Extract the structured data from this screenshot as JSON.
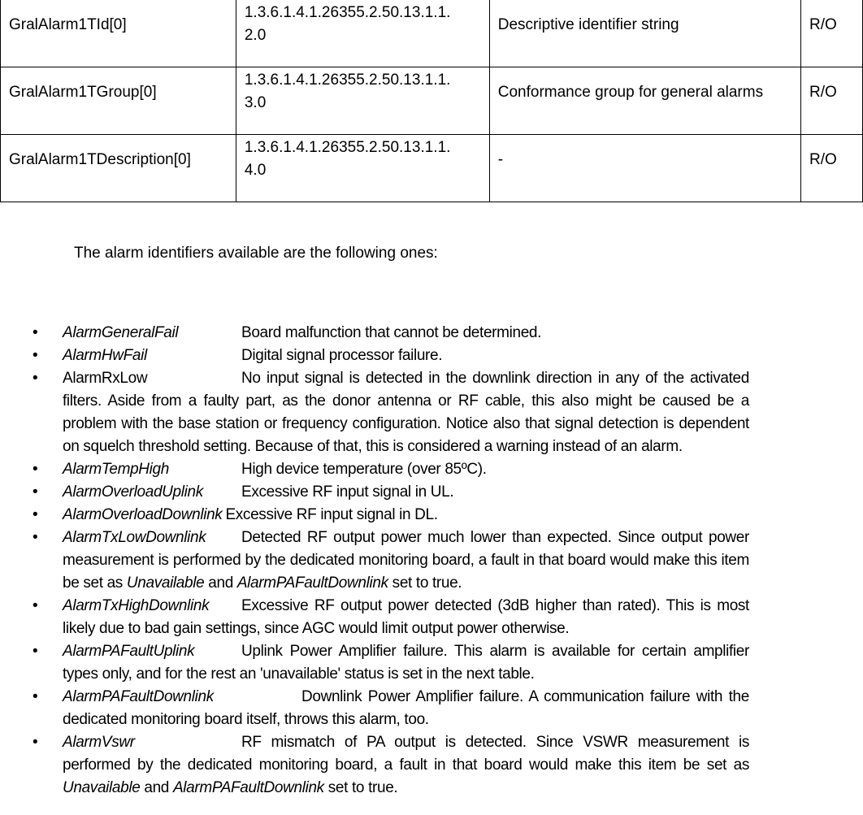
{
  "table": {
    "rows": [
      {
        "name": "GralAlarm1TId[0]",
        "oid_line1": "1.3.6.1.4.1.26355.2.50.13.1.1.",
        "oid_line2": "2.0",
        "description": "Descriptive identifier string",
        "access": "R/O"
      },
      {
        "name": "GralAlarm1TGroup[0]",
        "oid_line1": "1.3.6.1.4.1.26355.2.50.13.1.1.",
        "oid_line2": "3.0",
        "description": "Conformance group for general alarms",
        "access": "R/O"
      },
      {
        "name": "GralAlarm1TDescription[0]",
        "oid_line1": "1.3.6.1.4.1.26355.2.50.13.1.1.",
        "oid_line2": "4.0",
        "description": "-",
        "access": "R/O"
      }
    ]
  },
  "intro": "The alarm identifiers available are the following ones:",
  "bullet_glyph": "•",
  "alarms": [
    {
      "name": "AlarmGeneralFail",
      "desc": "Board malfunction that cannot be determined."
    },
    {
      "name": "AlarmHwFail",
      "desc": "Digital signal processor failure."
    },
    {
      "name": "AlarmRxLow",
      "desc": "No input signal is detected in the downlink direction in any of the activated filters. Aside from a faulty part, as the donor antenna or RF cable, this also might be caused be a problem with the base station or frequency configuration. Notice also that signal detection is dependent on squelch threshold setting. Because of that, this is considered a warning instead of an alarm."
    },
    {
      "name": "AlarmTempHigh",
      "desc": "High device temperature (over 85ºC)."
    },
    {
      "name": "AlarmOverloadUplink",
      "desc": "Excessive RF input signal in UL."
    },
    {
      "name": "AlarmOverloadDownlink",
      "desc": "Excessive RF input signal in DL."
    },
    {
      "name": "AlarmTxLowDownlink",
      "desc_a": "Detected RF output power much lower than expected. Since output power measurement is performed by the dedicated monitoring board, a fault in that board would make this item be set as ",
      "em1": "Unavailable",
      "desc_b": " and ",
      "em2": "AlarmPAFaultDownlink",
      "desc_c": " set to true."
    },
    {
      "name": "AlarmTxHighDownlink",
      "desc": "Excessive RF output power detected (3dB higher than rated). This is most likely due to bad gain settings, since AGC would limit output power otherwise."
    },
    {
      "name": "AlarmPAFaultUplink",
      "desc": "Uplink Power Amplifier failure. This alarm is available for certain amplifier types only, and for the rest an 'unavailable' status is set in the next table."
    },
    {
      "name": "AlarmPAFaultDownlink",
      "desc": "Downlink Power Amplifier failure. A communication failure with the dedicated monitoring board itself, throws this alarm, too."
    },
    {
      "name": "AlarmVswr",
      "desc_a": "RF mismatch of PA output is detected. Since VSWR measurement is performed by the dedicated monitoring board, a fault in that board would make this item be set as ",
      "em1": "Unavailable",
      "desc_b": " and ",
      "em2": "AlarmPAFaultDownlink",
      "desc_c": " set to true."
    }
  ]
}
